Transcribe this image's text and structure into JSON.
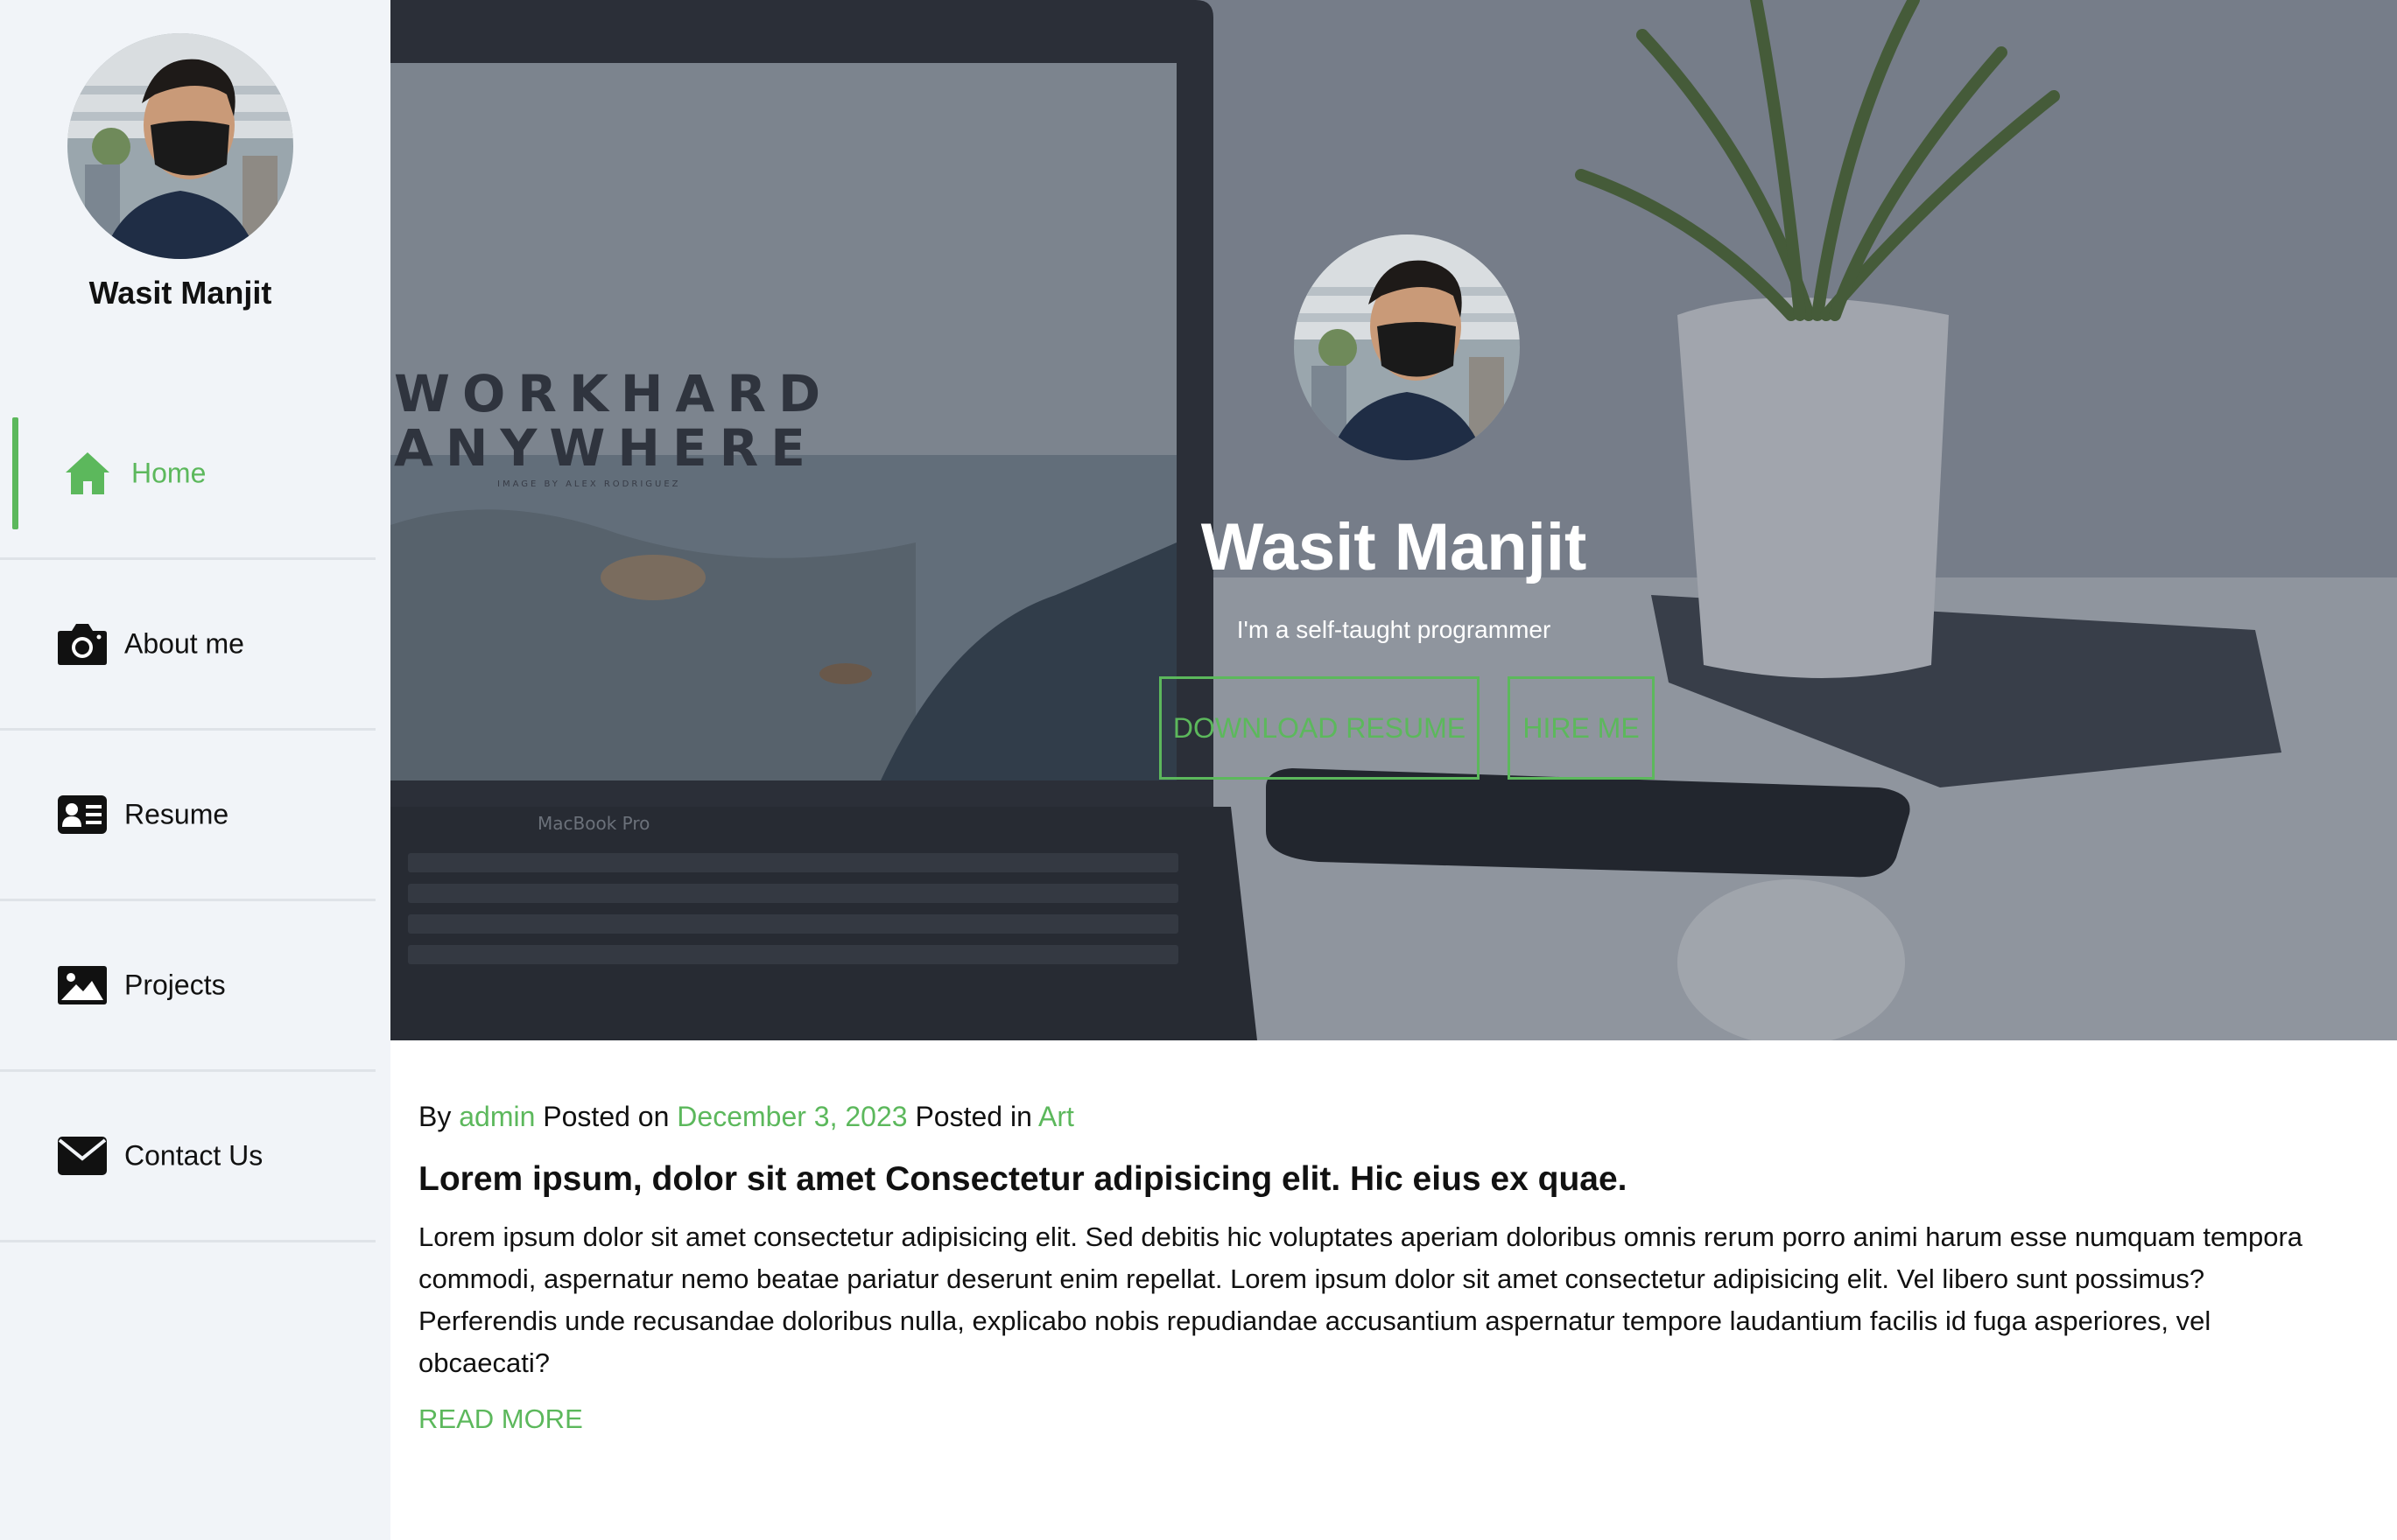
{
  "sidebar": {
    "profile_name": "Wasit Manjit",
    "nav": [
      {
        "label": "Home",
        "icon": "home-icon",
        "active": true
      },
      {
        "label": "About me",
        "icon": "camera-icon",
        "active": false
      },
      {
        "label": "Resume",
        "icon": "id-card-icon",
        "active": false
      },
      {
        "label": "Projects",
        "icon": "image-icon",
        "active": false
      },
      {
        "label": "Contact Us",
        "icon": "envelope-icon",
        "active": false
      }
    ]
  },
  "hero": {
    "name": "Wasit Manjit",
    "tagline": "I'm a self-taught programmer",
    "buttons": {
      "download_resume": "DOWNLOAD RESUME",
      "hire_me": "HIRE ME"
    },
    "background": {
      "screen_text_line1": "WORKHARD",
      "screen_text_line2": "ANYWHERE",
      "screen_credit": "IMAGE BY ALEX RODRIGUEZ",
      "laptop_label": "MacBook Pro"
    }
  },
  "post": {
    "by_label": "By",
    "author": "admin",
    "posted_on_label": "Posted on",
    "date": "December 3, 2023",
    "posted_in_label": "Posted in",
    "category": "Art",
    "title": "Lorem ipsum, dolor sit amet Consectetur adipisicing elit. Hic eius ex quae.",
    "excerpt": "Lorem ipsum dolor sit amet consectetur adipisicing elit. Sed debitis hic voluptates aperiam doloribus omnis rerum porro animi harum esse numquam tempora commodi, aspernatur nemo beatae pariatur deserunt enim repellat. Lorem ipsum dolor sit amet consectetur adipisicing elit. Vel libero sunt possimus? Perferendis unde recusandae doloribus nulla, explicabo nobis repudiandae accusantium aspernatur tempore laudantium facilis id fuga asperiores, vel obcaecati?",
    "read_more": "READ MORE"
  },
  "colors": {
    "accent": "#5cb85c",
    "sidebar_bg": "#f1f4f8",
    "text": "#111111"
  }
}
